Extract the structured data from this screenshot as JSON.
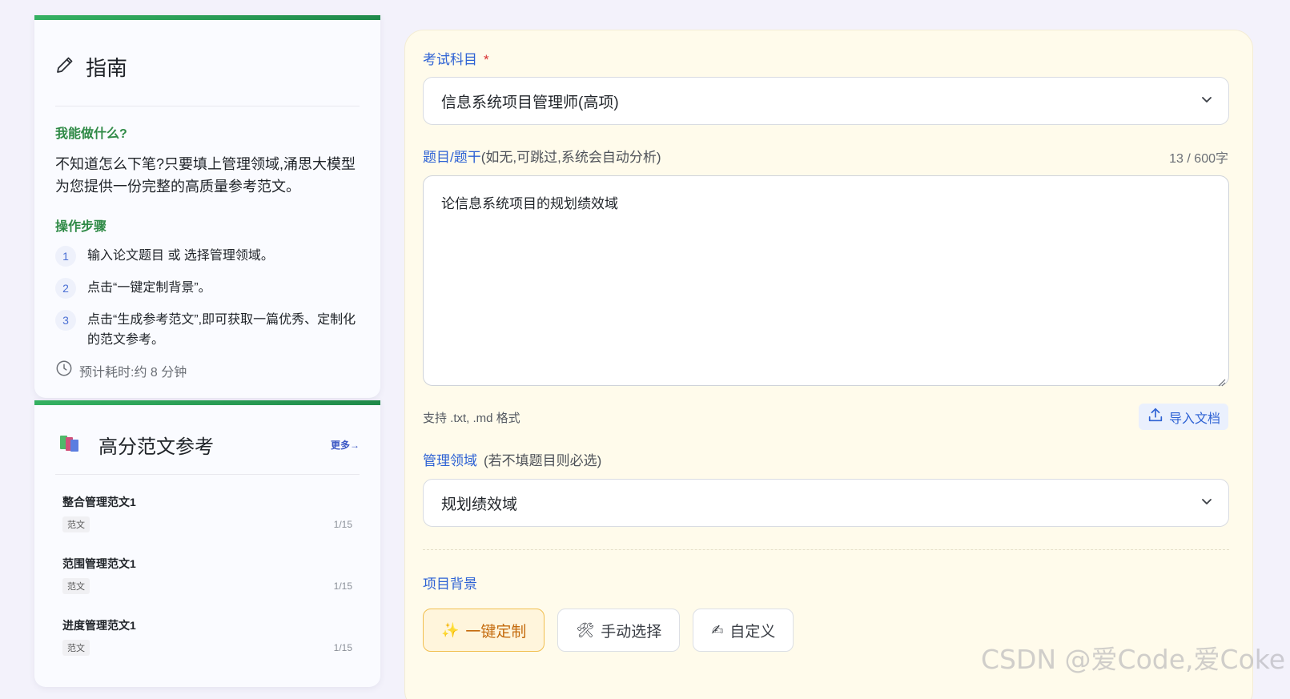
{
  "guide": {
    "title": "指南",
    "can_do_label": "我能做什么?",
    "description": "不知道怎么下笔?只要填上管理领域,涌思大模型为您提供一份完整的高质量参考范文。",
    "steps_label": "操作步骤",
    "steps": [
      {
        "num": "1",
        "text": "输入论文题目 或 选择管理领域。"
      },
      {
        "num": "2",
        "text": "点击“一键定制背景”。"
      },
      {
        "num": "3",
        "text": "点击“生成参考范文”,即可获取一篇优秀、定制化的范文参考。"
      }
    ],
    "estimate": "预计耗时:约 8 分钟"
  },
  "references": {
    "title": "高分范文参考",
    "more": "更多→",
    "items": [
      {
        "name": "整合管理范文1",
        "tag": "范文",
        "count": "1/15"
      },
      {
        "name": "范围管理范文1",
        "tag": "范文",
        "count": "1/15"
      },
      {
        "name": "进度管理范文1",
        "tag": "范文",
        "count": "1/15"
      }
    ]
  },
  "form": {
    "subject_label": "考试科目",
    "required_mark": "*",
    "subject_value": "信息系统项目管理师(高项)",
    "topic_label": "题目/题干",
    "topic_hint": "(如无,可跳过,系统会自动分析)",
    "topic_counter": "13 / 600字",
    "topic_value": "论信息系统项目的规划绩效域",
    "support_text": "支持 .txt, .md 格式",
    "import_label": "导入文档",
    "domain_label": "管理领域",
    "domain_hint": "(若不填题目则必选)",
    "domain_value": "规划绩效域",
    "background_label": "项目背景",
    "background_buttons": [
      {
        "emoji": "✨",
        "label": "一键定制",
        "active": true
      },
      {
        "emoji": "🛠",
        "label": "手动选择",
        "active": false
      },
      {
        "emoji": "✍",
        "label": "自定义",
        "active": false
      }
    ]
  },
  "watermark": "CSDN @爱Code,爱Coke",
  "colors": {
    "accent_green": "#2f8a46",
    "accent_blue": "#2e62d4",
    "active_orange": "#c46a0c",
    "panel_bg": "#fffbeb"
  }
}
